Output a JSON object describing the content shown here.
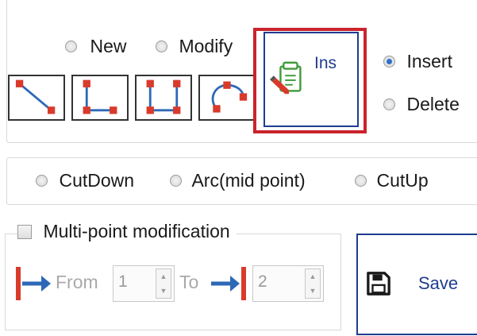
{
  "mode_radios": {
    "new": "New",
    "modify": "Modify"
  },
  "ins_button": {
    "label": "Ins"
  },
  "insert_delete": {
    "insert": "Insert",
    "delete": "Delete"
  },
  "arc_options": {
    "cut_down": "CutDown",
    "arc_mid": "Arc(mid point)",
    "cut_up": "CutUp"
  },
  "multipoint": {
    "title": "Multi-point modification",
    "from_label": "From",
    "from_value": "1",
    "to_label": "To",
    "to_value": "2"
  },
  "save_button": {
    "label": "Save"
  },
  "colors": {
    "highlight": "#c9242d",
    "accent": "#1f3c8f",
    "point": "#d93a2b"
  }
}
